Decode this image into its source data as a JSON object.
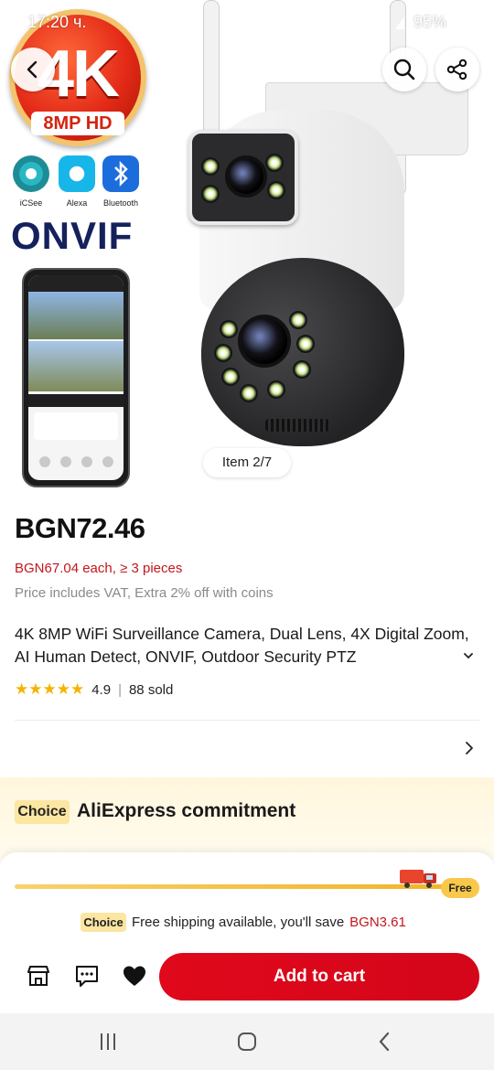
{
  "status_bar": {
    "time": "17:20 ч.",
    "battery": "95%"
  },
  "hero": {
    "badge_big": "4K",
    "badge_small": "8MP HD",
    "apps": [
      {
        "name": "iCSee",
        "color": "#2ab7c4"
      },
      {
        "name": "Alexa",
        "color": "#17b6e8"
      },
      {
        "name": "Bluetooth",
        "color": "#1c6ddc"
      }
    ],
    "onvif": "ONVIF",
    "item_counter": "Item 2/7"
  },
  "product": {
    "price": "BGN72.46",
    "bulk_price": "BGN67.04 each, ≥ 3 pieces",
    "vat_note": "Price includes VAT, Extra 2% off with coins",
    "title": "4K 8MP WiFi Surveillance Camera, Dual Lens, 4X Digital Zoom, AI Human Detect, ONVIF, Outdoor Security PTZ",
    "rating": "4.9",
    "sold": "88 sold"
  },
  "commitment": {
    "choice_tag": "Choice",
    "title": "AliExpress commitment"
  },
  "shipping_sheet": {
    "free_label": "Free",
    "choice_tag": "Choice",
    "message": "Free shipping available, you'll save",
    "savings": "BGN3.61"
  },
  "actions": {
    "add_to_cart": "Add to cart"
  },
  "colors": {
    "accent_red": "#d4061a",
    "price_red": "#c4161c",
    "choice_yellow": "#fbe6a2",
    "star": "#f5b301"
  }
}
